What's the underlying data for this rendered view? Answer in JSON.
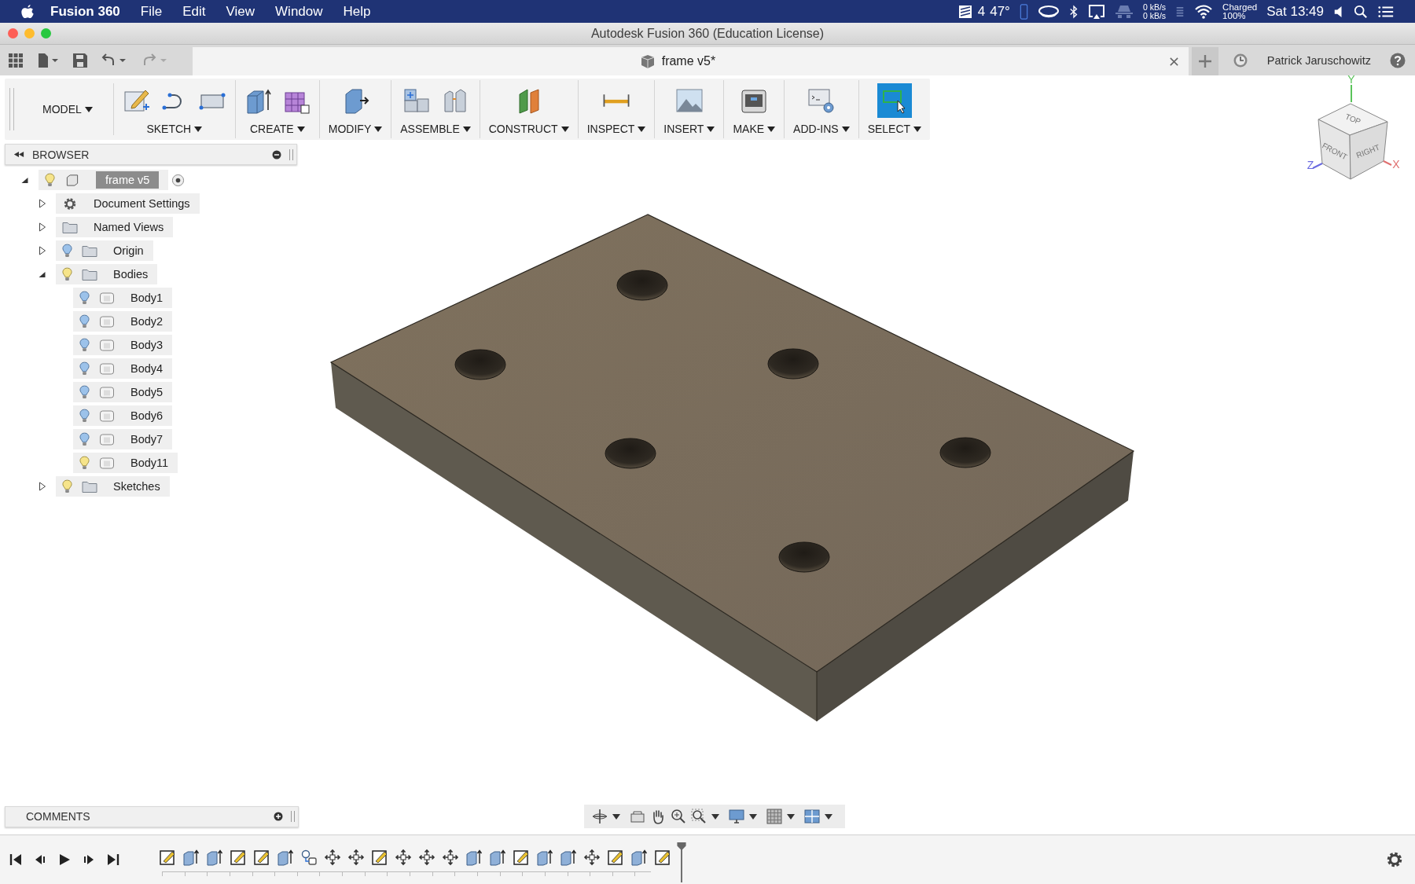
{
  "menubar": {
    "app_name": "Fusion 360",
    "menus": [
      "File",
      "Edit",
      "View",
      "Window",
      "Help"
    ],
    "status": {
      "notes_count": "4",
      "temperature": "47°",
      "upload": "0 kB/s",
      "download": "0 kB/s",
      "battery_state": "Charged",
      "battery_level": "100%",
      "clock": "Sat 13:49"
    }
  },
  "window": {
    "title": "Autodesk Fusion 360 (Education License)"
  },
  "document_tab": {
    "title": "frame v5*"
  },
  "user": {
    "name": "Patrick Jaruschowitz"
  },
  "toolbar": {
    "mode": "MODEL",
    "groups": [
      {
        "label": "SKETCH",
        "selected": false,
        "tools": [
          {
            "kind": "sketch"
          },
          {
            "kind": "arc"
          },
          {
            "kind": "rectangle"
          }
        ]
      },
      {
        "label": "CREATE",
        "selected": false,
        "tools": [
          {
            "kind": "extrude"
          },
          {
            "kind": "form"
          }
        ]
      },
      {
        "label": "MODIFY",
        "selected": false,
        "tools": [
          {
            "kind": "presspull"
          }
        ]
      },
      {
        "label": "ASSEMBLE",
        "selected": false,
        "tools": [
          {
            "kind": "component"
          },
          {
            "kind": "joint"
          }
        ]
      },
      {
        "label": "CONSTRUCT",
        "selected": false,
        "tools": [
          {
            "kind": "plane"
          }
        ]
      },
      {
        "label": "INSPECT",
        "selected": false,
        "tools": [
          {
            "kind": "measure"
          }
        ]
      },
      {
        "label": "INSERT",
        "selected": false,
        "tools": [
          {
            "kind": "image"
          }
        ]
      },
      {
        "label": "MAKE",
        "selected": false,
        "tools": [
          {
            "kind": "print"
          }
        ]
      },
      {
        "label": "ADD-INS",
        "selected": false,
        "tools": [
          {
            "kind": "scripts"
          }
        ]
      },
      {
        "label": "SELECT",
        "selected": true,
        "tools": [
          {
            "kind": "select"
          }
        ]
      }
    ]
  },
  "browser": {
    "title": "BROWSER",
    "tree": [
      {
        "label": "frame v5",
        "kind": "component",
        "bulb_lit": true,
        "expanded": true,
        "selected": true,
        "children": [
          {
            "label": "Document Settings",
            "kind": "settings",
            "expanded": false,
            "selected": false
          },
          {
            "label": "Named Views",
            "kind": "folder",
            "expanded": false,
            "selected": false
          },
          {
            "label": "Origin",
            "kind": "folder",
            "bulb_lit": false,
            "expanded": false,
            "selected": false
          },
          {
            "label": "Bodies",
            "kind": "folder",
            "bulb_lit": true,
            "expanded": true,
            "selected": false,
            "children": [
              {
                "label": "Body1",
                "kind": "body",
                "bulb_lit": false,
                "selected": false
              },
              {
                "label": "Body2",
                "kind": "body",
                "bulb_lit": false,
                "selected": false
              },
              {
                "label": "Body3",
                "kind": "body",
                "bulb_lit": false,
                "selected": false
              },
              {
                "label": "Body4",
                "kind": "body",
                "bulb_lit": false,
                "selected": false
              },
              {
                "label": "Body5",
                "kind": "body",
                "bulb_lit": false,
                "selected": false
              },
              {
                "label": "Body6",
                "kind": "body",
                "bulb_lit": false,
                "selected": false
              },
              {
                "label": "Body7",
                "kind": "body",
                "bulb_lit": false,
                "selected": false
              },
              {
                "label": "Body11",
                "kind": "body",
                "bulb_lit": true,
                "selected": false
              }
            ]
          },
          {
            "label": "Sketches",
            "kind": "folder",
            "bulb_lit": true,
            "expanded": false,
            "selected": false
          }
        ]
      }
    ]
  },
  "viewcube": {
    "top_label": "TOP",
    "front_label": "FRONT",
    "right_label": "RIGHT",
    "x_axis": "X",
    "y_axis": "Y",
    "z_axis": "Z"
  },
  "comments": {
    "title": "COMMENTS"
  },
  "timeline": {
    "steps": [
      {
        "kind": "sketch"
      },
      {
        "kind": "extrude"
      },
      {
        "kind": "extrude"
      },
      {
        "kind": "sketch"
      },
      {
        "kind": "sketch"
      },
      {
        "kind": "extrude"
      },
      {
        "kind": "joint"
      },
      {
        "kind": "move"
      },
      {
        "kind": "move"
      },
      {
        "kind": "sketch"
      },
      {
        "kind": "move"
      },
      {
        "kind": "move"
      },
      {
        "kind": "move"
      },
      {
        "kind": "extrude"
      },
      {
        "kind": "extrude"
      },
      {
        "kind": "sketch"
      },
      {
        "kind": "extrude"
      },
      {
        "kind": "extrude"
      },
      {
        "kind": "move"
      },
      {
        "kind": "sketch"
      },
      {
        "kind": "extrude"
      },
      {
        "kind": "sketch"
      }
    ]
  }
}
